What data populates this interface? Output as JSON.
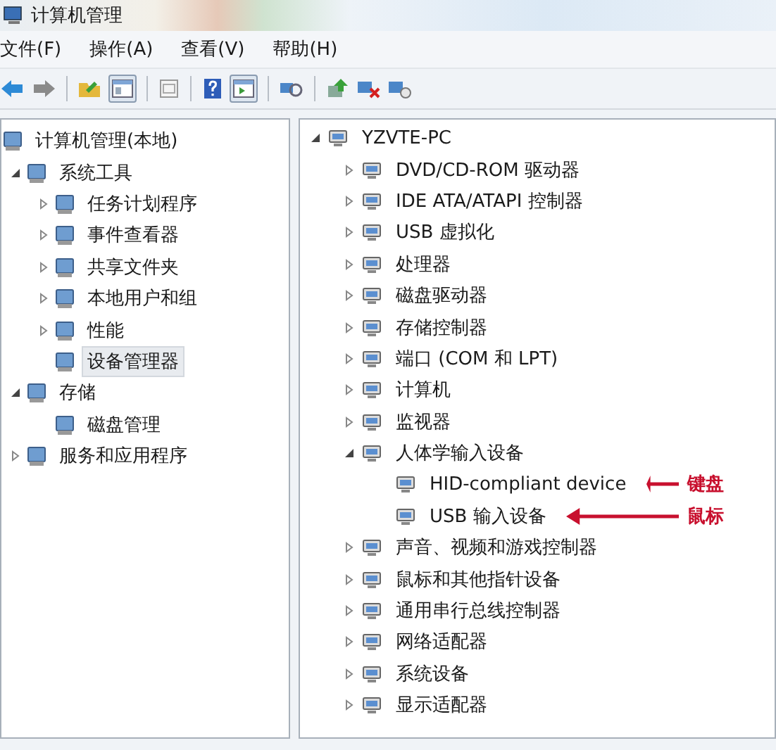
{
  "window": {
    "title": "计算机管理"
  },
  "menu": [
    "文件(F)",
    "操作(A)",
    "查看(V)",
    "帮助(H)"
  ],
  "left_tree": [
    {
      "label": "计算机管理(本地)",
      "selected": false,
      "children": [
        {
          "label": "系统工具",
          "expanded": true,
          "selected": false,
          "children": [
            {
              "label": "任务计划程序",
              "expanded": false,
              "selected": false
            },
            {
              "label": "事件查看器",
              "expanded": false,
              "selected": false
            },
            {
              "label": "共享文件夹",
              "expanded": false,
              "selected": false
            },
            {
              "label": "本地用户和组",
              "expanded": false,
              "selected": false
            },
            {
              "label": "性能",
              "expanded": false,
              "selected": false
            },
            {
              "label": "设备管理器",
              "selected": true
            }
          ]
        },
        {
          "label": "存储",
          "expanded": true,
          "selected": false,
          "children": [
            {
              "label": "磁盘管理",
              "selected": false
            }
          ]
        },
        {
          "label": "服务和应用程序",
          "expanded": false,
          "selected": false
        }
      ]
    }
  ],
  "device_tree": [
    {
      "label": "YZVTE-PC",
      "expanded": true,
      "children": [
        {
          "label": "DVD/CD-ROM 驱动器",
          "expanded": false
        },
        {
          "label": "IDE ATA/ATAPI 控制器",
          "expanded": false
        },
        {
          "label": "USB 虚拟化",
          "expanded": false
        },
        {
          "label": "处理器",
          "expanded": false
        },
        {
          "label": "磁盘驱动器",
          "expanded": false
        },
        {
          "label": "存储控制器",
          "expanded": false
        },
        {
          "label": "端口 (COM 和 LPT)",
          "expanded": false
        },
        {
          "label": "计算机",
          "expanded": false
        },
        {
          "label": "监视器",
          "expanded": false
        },
        {
          "label": "人体学输入设备",
          "expanded": true,
          "children": [
            {
              "label": "HID-compliant device",
              "annotation": "键盘"
            },
            {
              "label": "USB 输入设备",
              "annotation": "鼠标"
            }
          ]
        },
        {
          "label": "声音、视频和游戏控制器",
          "expanded": false
        },
        {
          "label": "鼠标和其他指针设备",
          "expanded": false
        },
        {
          "label": "通用串行总线控制器",
          "expanded": false
        },
        {
          "label": "网络适配器",
          "expanded": false
        },
        {
          "label": "系统设备",
          "expanded": false
        },
        {
          "label": "显示适配器",
          "expanded": false
        }
      ]
    }
  ]
}
